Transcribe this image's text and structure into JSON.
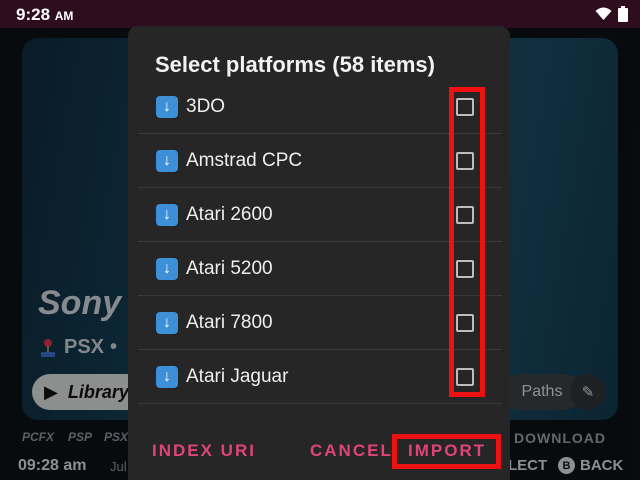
{
  "status_bar": {
    "time": "9:28",
    "ampm": "AM"
  },
  "background": {
    "hero_title": "Sony",
    "hero_subtitle": "PSX",
    "library_label": "Library",
    "paths_label": "Paths",
    "platform_tabs": [
      "PCFX",
      "PSP",
      "PSX"
    ],
    "download_tab": "DOWNLOAD",
    "bottom_time": "09:28 am",
    "bottom_date": "Jul",
    "select_label": "LECT",
    "back_label": "BACK",
    "back_button_glyph": "B"
  },
  "dialog": {
    "title": "Select platforms (58 items)",
    "items": [
      {
        "label": "3DO",
        "checked": false
      },
      {
        "label": "Amstrad CPC",
        "checked": false
      },
      {
        "label": "Atari 2600",
        "checked": false
      },
      {
        "label": "Atari 5200",
        "checked": false
      },
      {
        "label": "Atari 7800",
        "checked": false
      },
      {
        "label": "Atari Jaguar",
        "checked": false
      }
    ],
    "actions": {
      "index_uri": "INDEX URI",
      "cancel": "CANCEL",
      "import": "IMPORT"
    }
  },
  "colors": {
    "accent": "#e04477",
    "highlight": "#ee1111",
    "dialog_bg": "#262626",
    "download_icon": "#3d8fd8"
  }
}
